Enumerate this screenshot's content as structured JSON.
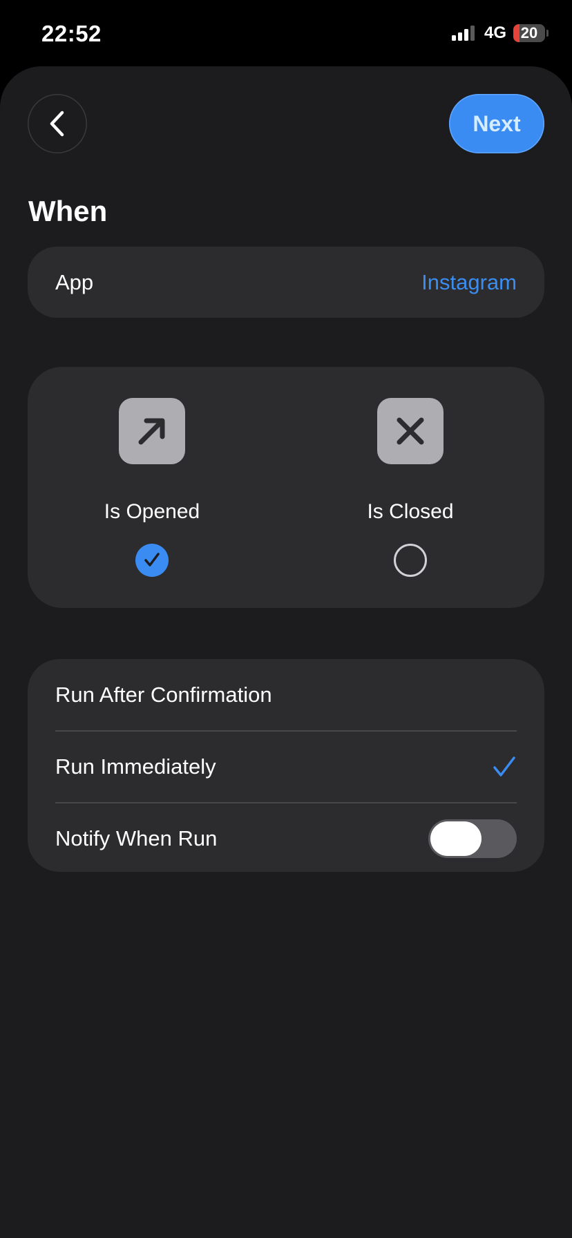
{
  "status_bar": {
    "time": "22:52",
    "network": "4G",
    "battery_level": "20",
    "battery_color": "#e5443a"
  },
  "header": {
    "back_icon": "chevron-left-icon",
    "next_label": "Next"
  },
  "section": {
    "title": "When"
  },
  "app_row": {
    "label": "App",
    "value": "Instagram"
  },
  "trigger": {
    "options": [
      {
        "label": "Is Opened",
        "icon": "arrow-up-right-icon",
        "selected": true
      },
      {
        "label": "Is Closed",
        "icon": "x-mark-icon",
        "selected": false
      }
    ]
  },
  "run_options": {
    "items": [
      {
        "label": "Run After Confirmation",
        "checked": false
      },
      {
        "label": "Run Immediately",
        "checked": true
      },
      {
        "label": "Notify When Run",
        "toggle_on": false
      }
    ]
  },
  "colors": {
    "accent": "#3a8cf3",
    "background": "#1c1c1e",
    "card": "#2c2c2e"
  }
}
